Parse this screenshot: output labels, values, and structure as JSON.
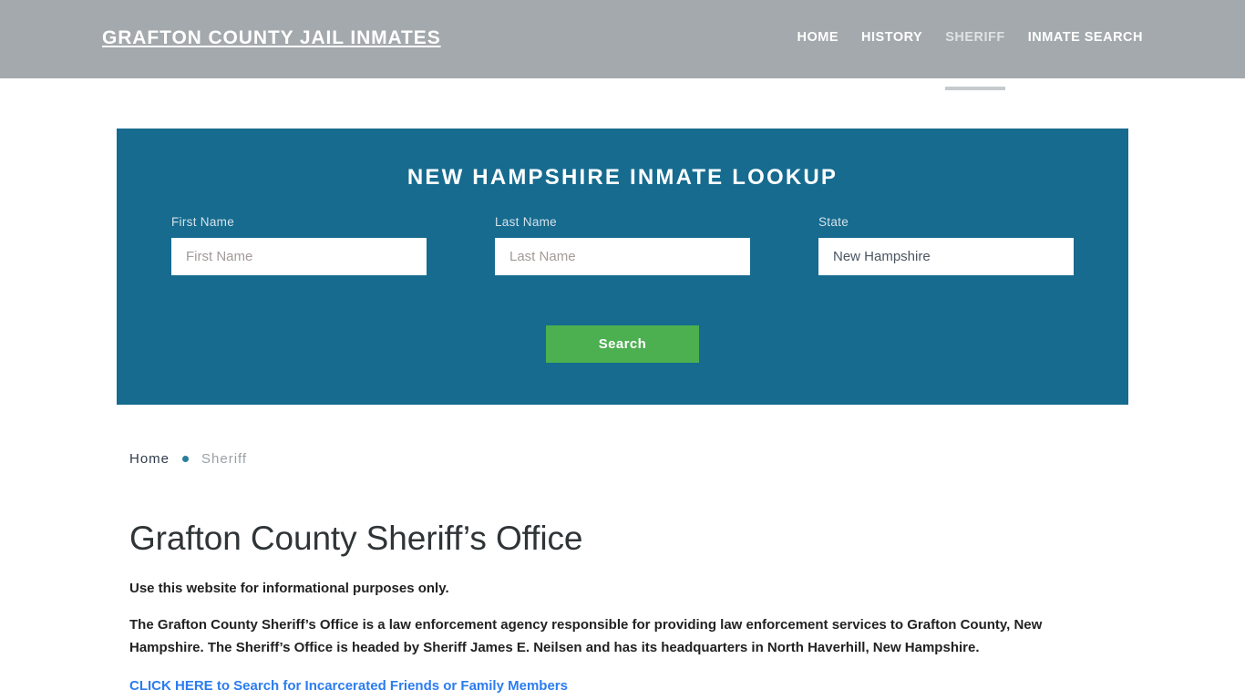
{
  "header": {
    "brand": "Grafton County Jail Inmates",
    "nav": [
      {
        "label": "HOME",
        "active": false
      },
      {
        "label": "HISTORY",
        "active": false
      },
      {
        "label": "SHERIFF",
        "active": true
      },
      {
        "label": "INMATE SEARCH",
        "active": false
      }
    ]
  },
  "lookup": {
    "title": "NEW HAMPSHIRE INMATE LOOKUP",
    "first_name": {
      "label": "First Name",
      "placeholder": "First Name",
      "value": ""
    },
    "last_name": {
      "label": "Last Name",
      "placeholder": "Last Name",
      "value": ""
    },
    "state": {
      "label": "State",
      "placeholder": "State",
      "value": "New Hampshire"
    },
    "search_label": "Search",
    "panel_color": "#166b8f",
    "button_color": "#4caf50"
  },
  "breadcrumb": {
    "home": "Home",
    "current": "Sheriff",
    "dot_color": "#2a7e9b"
  },
  "main": {
    "title": "Grafton County Sheriff’s Office",
    "lead": "Use this website for informational purposes only.",
    "paragraph": "The Grafton County Sheriff’s Office is a law enforcement agency responsible for providing law enforcement services to Grafton County, New Hampshire. The Sheriff’s Office is headed by Sheriff James E. Neilsen and has its headquarters in North Haverhill, New Hampshire.",
    "cta": "CLICK HERE to Search for Incarcerated Friends or Family Members",
    "cta_color": "#2b7cf0"
  }
}
